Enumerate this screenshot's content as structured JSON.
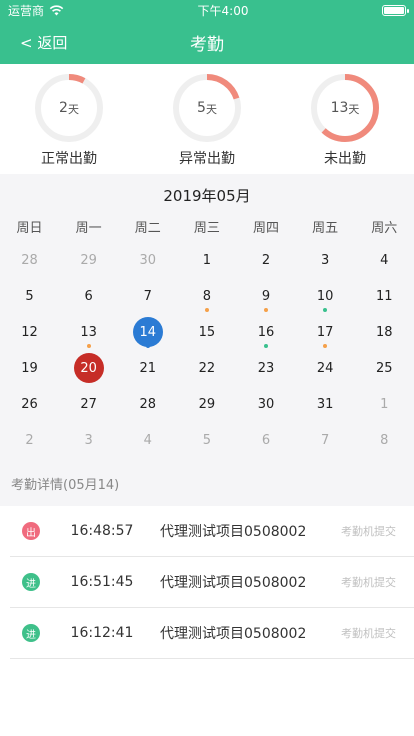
{
  "status_bar": {
    "carrier": "运营商",
    "time": "下午4:00"
  },
  "nav": {
    "back_label": "< 返回",
    "title": "考勤"
  },
  "colors": {
    "header_bg": "#39c08e",
    "ring_fg": "#f08a7c",
    "ring_bg": "#efefef",
    "selected_day": "#2b7bd4",
    "today_day": "#c62d27",
    "dot_orange": "#f5a04a",
    "dot_green": "#39c08e",
    "badge_out": "#f06b7e",
    "badge_in": "#3fc08a"
  },
  "summary": [
    {
      "value": "2",
      "unit": "天",
      "label": "正常出勤",
      "fraction": 0.08
    },
    {
      "value": "5",
      "unit": "天",
      "label": "异常出勤",
      "fraction": 0.2
    },
    {
      "value": "13",
      "unit": "天",
      "label": "未出勤",
      "fraction": 0.62
    }
  ],
  "calendar": {
    "month_label": "2019年05月",
    "weekdays": [
      "周日",
      "周一",
      "周二",
      "周三",
      "周四",
      "周五",
      "周六"
    ],
    "days": [
      {
        "d": "28",
        "m": true
      },
      {
        "d": "29",
        "m": true
      },
      {
        "d": "30",
        "m": true
      },
      {
        "d": "1"
      },
      {
        "d": "2"
      },
      {
        "d": "3"
      },
      {
        "d": "4"
      },
      {
        "d": "5"
      },
      {
        "d": "6"
      },
      {
        "d": "7"
      },
      {
        "d": "8",
        "dot": "orange"
      },
      {
        "d": "9",
        "dot": "orange"
      },
      {
        "d": "10",
        "dot": "green"
      },
      {
        "d": "11"
      },
      {
        "d": "12"
      },
      {
        "d": "13",
        "dot": "orange"
      },
      {
        "d": "14",
        "state": "selected",
        "dot": "blue"
      },
      {
        "d": "15"
      },
      {
        "d": "16",
        "dot": "green"
      },
      {
        "d": "17",
        "dot": "orange"
      },
      {
        "d": "18"
      },
      {
        "d": "19"
      },
      {
        "d": "20",
        "state": "today"
      },
      {
        "d": "21"
      },
      {
        "d": "22"
      },
      {
        "d": "23"
      },
      {
        "d": "24"
      },
      {
        "d": "25"
      },
      {
        "d": "26"
      },
      {
        "d": "27"
      },
      {
        "d": "28"
      },
      {
        "d": "29"
      },
      {
        "d": "30"
      },
      {
        "d": "31"
      },
      {
        "d": "1",
        "m": true
      },
      {
        "d": "2",
        "m": true
      },
      {
        "d": "3",
        "m": true
      },
      {
        "d": "4",
        "m": true
      },
      {
        "d": "5",
        "m": true
      },
      {
        "d": "6",
        "m": true
      },
      {
        "d": "7",
        "m": true
      },
      {
        "d": "8",
        "m": true
      }
    ]
  },
  "details": {
    "header": "考勤详情(05月14)",
    "records": [
      {
        "badge": "出",
        "kind": "out",
        "time": "16:48:57",
        "project": "代理测试项目0508002",
        "source": "考勤机提交"
      },
      {
        "badge": "进",
        "kind": "in",
        "time": "16:51:45",
        "project": "代理测试项目0508002",
        "source": "考勤机提交"
      },
      {
        "badge": "进",
        "kind": "in",
        "time": "16:12:41",
        "project": "代理测试项目0508002",
        "source": "考勤机提交"
      }
    ]
  }
}
